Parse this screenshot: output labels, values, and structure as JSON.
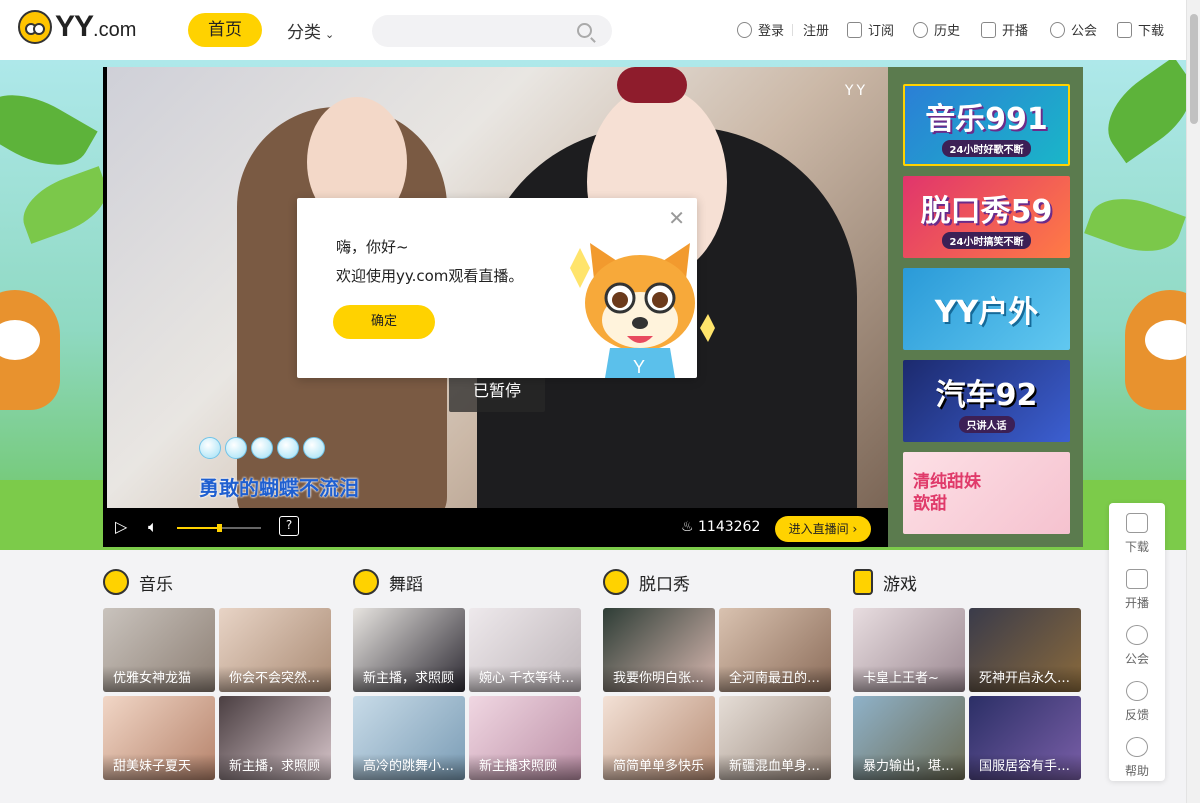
{
  "header": {
    "logo_text": "YY",
    "logo_suffix": ".com",
    "nav_home": "首页",
    "nav_category": "分类",
    "search_placeholder": "",
    "top_links": [
      "登录",
      "注册",
      "订阅",
      "历史",
      "开播",
      "公会",
      "下载"
    ]
  },
  "player": {
    "watermark": "YY",
    "lyric": "勇敢的蝴蝶不流泪",
    "paused_text": "已暂停",
    "heat_count": "1143262",
    "enter_room": "进入直播间",
    "volume_level": 0.5
  },
  "right_rail": [
    {
      "title": "音乐991",
      "subtitle": "24小时好歌不断"
    },
    {
      "title": "脱口秀59",
      "subtitle": "24小时搞笑不断"
    },
    {
      "title": "YY户外",
      "subtitle": ""
    },
    {
      "title": "汽车92",
      "subtitle": "只讲人话"
    },
    {
      "title": "清纯甜妹 歆甜",
      "subtitle": ""
    }
  ],
  "dialog": {
    "line1": "嗨，你好~",
    "line2": "欢迎使用yy.com观看直播。",
    "confirm": "确定"
  },
  "float_bar": [
    "下载",
    "开播",
    "公会",
    "反馈",
    "帮助"
  ],
  "sections": [
    {
      "title": "音乐",
      "items": [
        "优雅女神龙猫",
        "你会不会突然…",
        "甜美妹子夏天",
        "新主播，求照顾"
      ]
    },
    {
      "title": "舞蹈",
      "items": [
        "新主播，求照顾",
        "婉心 千衣等待…",
        "高冷的跳舞小…",
        "新主播求照顾"
      ]
    },
    {
      "title": "脱口秀",
      "items": [
        "我要你明白张…",
        "全河南最丑的…",
        "简简单单多快乐",
        "新疆混血单身…"
      ]
    },
    {
      "title": "游戏",
      "items": [
        "卡皇上王者~",
        "死神开启永久…",
        "暴力输出，堪…",
        "国服居容有手…"
      ]
    }
  ],
  "colors": {
    "accent": "#ffd200",
    "page_bg": "#f3f3f5"
  }
}
